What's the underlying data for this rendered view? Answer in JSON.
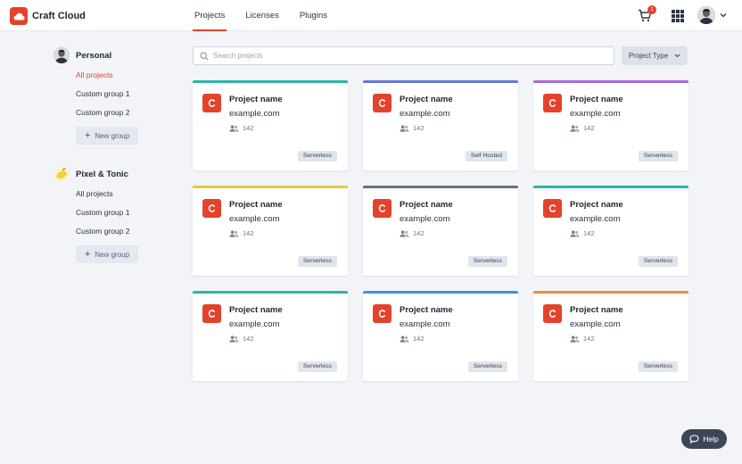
{
  "app": {
    "title": "Craft Cloud"
  },
  "nav": {
    "tabs": [
      "Projects",
      "Licenses",
      "Plugins"
    ],
    "active": 0
  },
  "header": {
    "cart_count": "1"
  },
  "sidebar": {
    "orgs": [
      {
        "name": "Personal",
        "avatar": "user-photo",
        "items": [
          "All projects",
          "Custom group 1",
          "Custom group 2"
        ],
        "active_item": 0,
        "new_group_label": "New group"
      },
      {
        "name": "Pixel & Tonic",
        "avatar": "pixel-tonic-lemon-logo",
        "items": [
          "All projects",
          "Custom group 1",
          "Custom group 2"
        ],
        "active_item": null,
        "new_group_label": "New group"
      }
    ]
  },
  "search": {
    "placeholder": "Search projects",
    "value": ""
  },
  "filter": {
    "label": "Project Type"
  },
  "projects": [
    {
      "name": "Project name",
      "domain": "example.com",
      "users": "142",
      "type": "Serverless",
      "accent": "#2bb5a6"
    },
    {
      "name": "Project name",
      "domain": "example.com",
      "users": "142",
      "type": "Self Hosted",
      "accent": "#6478d9"
    },
    {
      "name": "Project name",
      "domain": "example.com",
      "users": "142",
      "type": "Serverless",
      "accent": "#a86ad9"
    },
    {
      "name": "Project name",
      "domain": "example.com",
      "users": "142",
      "type": "Serverless",
      "accent": "#ecc63e"
    },
    {
      "name": "Project name",
      "domain": "example.com",
      "users": "142",
      "type": "Serverless",
      "accent": "#6a6f86"
    },
    {
      "name": "Project name",
      "domain": "example.com",
      "users": "142",
      "type": "Serverless",
      "accent": "#2bb5a6"
    },
    {
      "name": "Project name",
      "domain": "example.com",
      "users": "142",
      "type": "Serverless",
      "accent": "#2bb5a6"
    },
    {
      "name": "Project name",
      "domain": "example.com",
      "users": "142",
      "type": "Serverless",
      "accent": "#3f95d8"
    },
    {
      "name": "Project name",
      "domain": "example.com",
      "users": "142",
      "type": "Serverless",
      "accent": "#f08a3c"
    }
  ],
  "help": {
    "label": "Help"
  },
  "colors": {
    "brand": "#e5422b",
    "background": "#f2f4f8"
  }
}
